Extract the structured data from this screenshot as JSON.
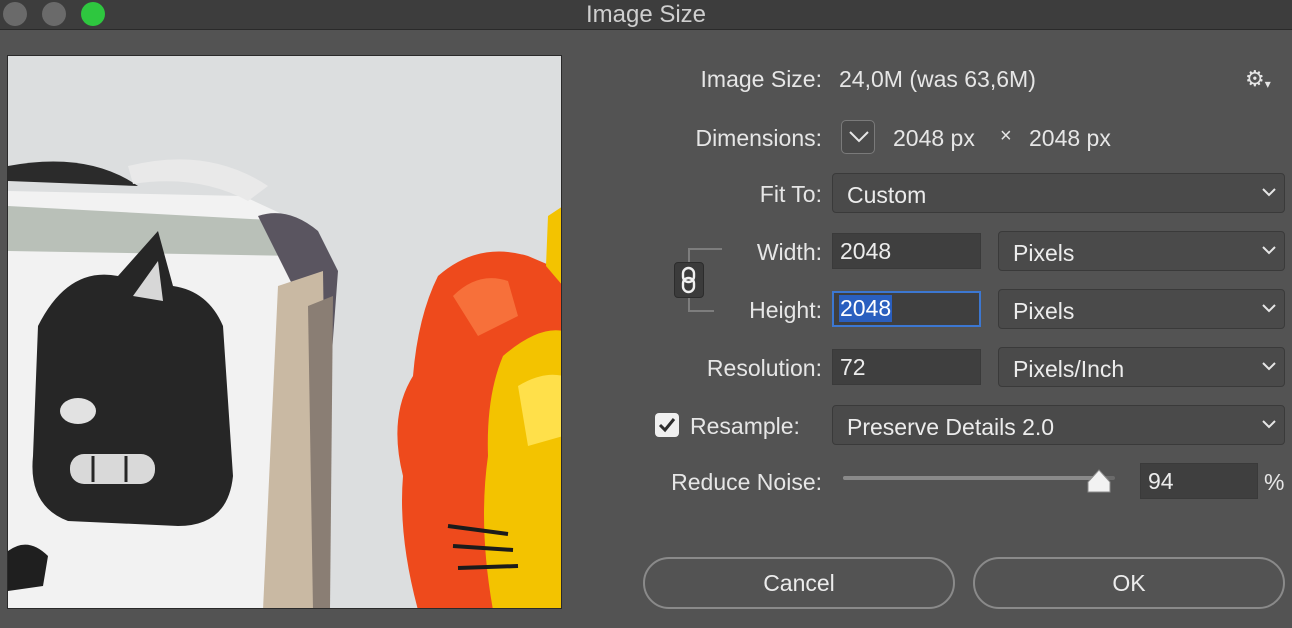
{
  "window": {
    "title": "Image Size"
  },
  "info": {
    "image_size_label": "Image Size:",
    "image_size_value": "24,0M (was 63,6M)",
    "dimensions_label": "Dimensions:",
    "dimensions_width": "2048 px",
    "dimensions_times": "×",
    "dimensions_height": "2048 px"
  },
  "fit_to": {
    "label": "Fit To:",
    "value": "Custom"
  },
  "width": {
    "label": "Width:",
    "value": "2048",
    "unit": "Pixels"
  },
  "height": {
    "label": "Height:",
    "value": "2048",
    "unit": "Pixels"
  },
  "resolution": {
    "label": "Resolution:",
    "value": "72",
    "unit": "Pixels/Inch"
  },
  "resample": {
    "label": "Resample:",
    "checked": true,
    "method": "Preserve Details 2.0"
  },
  "reduce_noise": {
    "label": "Reduce Noise:",
    "value": "94",
    "unit": "%",
    "level_percent": 94
  },
  "buttons": {
    "cancel": "Cancel",
    "ok": "OK"
  },
  "colors": {
    "accent": "#3c77d1",
    "close_button": "#6a6a6a",
    "zoom_button": "#2ec73f",
    "panel": "#535353"
  },
  "icons": [
    "gear-icon",
    "chevron-down-icon",
    "chain-link-icon",
    "checkmark-icon",
    "slider-thumb-icon"
  ]
}
